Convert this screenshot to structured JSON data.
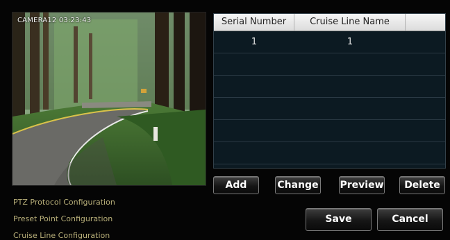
{
  "camera": {
    "osd": "CAMERA12  03:23:43"
  },
  "table": {
    "columns": [
      "Serial Number",
      "Cruise Line Name",
      ""
    ],
    "rows": [
      [
        "1",
        "1",
        ""
      ],
      [
        "",
        "",
        ""
      ],
      [
        "",
        "",
        ""
      ],
      [
        "",
        "",
        ""
      ],
      [
        "",
        "",
        ""
      ],
      [
        "",
        "",
        ""
      ]
    ]
  },
  "actions": {
    "add": "Add",
    "change": "Change",
    "preview": "Preview",
    "delete": "Delete"
  },
  "footer": {
    "save": "Save",
    "cancel": "Cancel"
  },
  "menu": {
    "items": [
      "PTZ Protocol Configuration",
      "Preset Point Configuration",
      "Cruise Line Configuration"
    ]
  }
}
